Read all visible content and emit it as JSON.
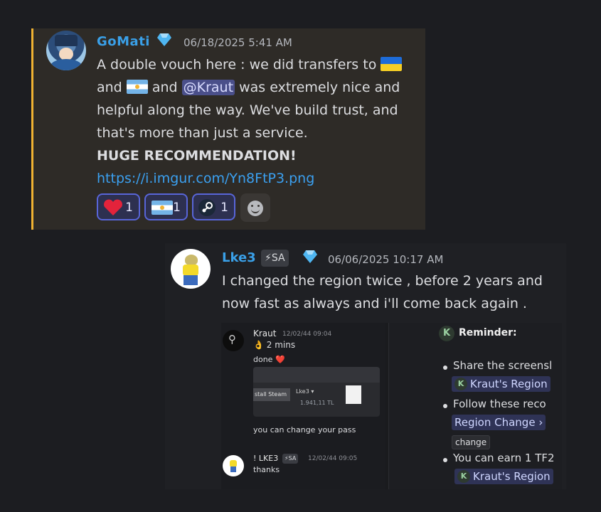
{
  "message1": {
    "username": "GoMati",
    "timestamp": "06/18/2025 5:41 AM",
    "lines": {
      "l1": "A double vouch here : we did transfers to",
      "l2a": "and",
      "l2b": "and",
      "mention": "@Kraut",
      "l2c": "was extremely nice and",
      "l3": "helpful along the way. We've build trust, and",
      "l4": "that's more than just a service.",
      "l5": "HUGE RECOMMENDATION!",
      "link": "https://i.imgur.com/Yn8FtP3.png"
    },
    "flags": [
      "ukraine-flag",
      "argentina-flag"
    ],
    "reactions": [
      {
        "icon": "heart-icon",
        "count": "1"
      },
      {
        "icon": "argentina-flag-icon",
        "count": "1"
      },
      {
        "icon": "steam-icon",
        "count": "1"
      }
    ],
    "colors": {
      "accent": "#f0b232",
      "username": "#3aa0e8",
      "link": "#3ba0f0"
    }
  },
  "message2": {
    "username": "Lke3",
    "tag": "⚡SA",
    "timestamp": "06/06/2025 10:17 AM",
    "lines": {
      "l1": "I changed the region twice , before 2 years and",
      "l2": "now fast as always and i'll come back again ."
    },
    "embed": {
      "left": {
        "kraut_name": "Kraut",
        "kraut_time": "12/02/44 09:04",
        "msg_a": "👌 2 mins",
        "msg_b": "done ❤️",
        "thumb_button": "stall Steam",
        "thumb_account": "Lke3 ▾",
        "thumb_balance": "1.941,11 TL",
        "msg_c": "you can change your pass",
        "lke_name": "! LKE3",
        "lke_tag": "⚡SA",
        "lke_time": "12/02/44 09:05",
        "msg_d": "thanks"
      },
      "right": {
        "title": "Reminder:",
        "item1": "Share the screensl",
        "chip1": "Kraut's Region",
        "item2": "Follow these reco",
        "chip2": "Region Change ›",
        "code": "change",
        "item3": "You can earn 1 TF2",
        "chip3": "Kraut's Region",
        "k_letter": "K"
      }
    }
  }
}
